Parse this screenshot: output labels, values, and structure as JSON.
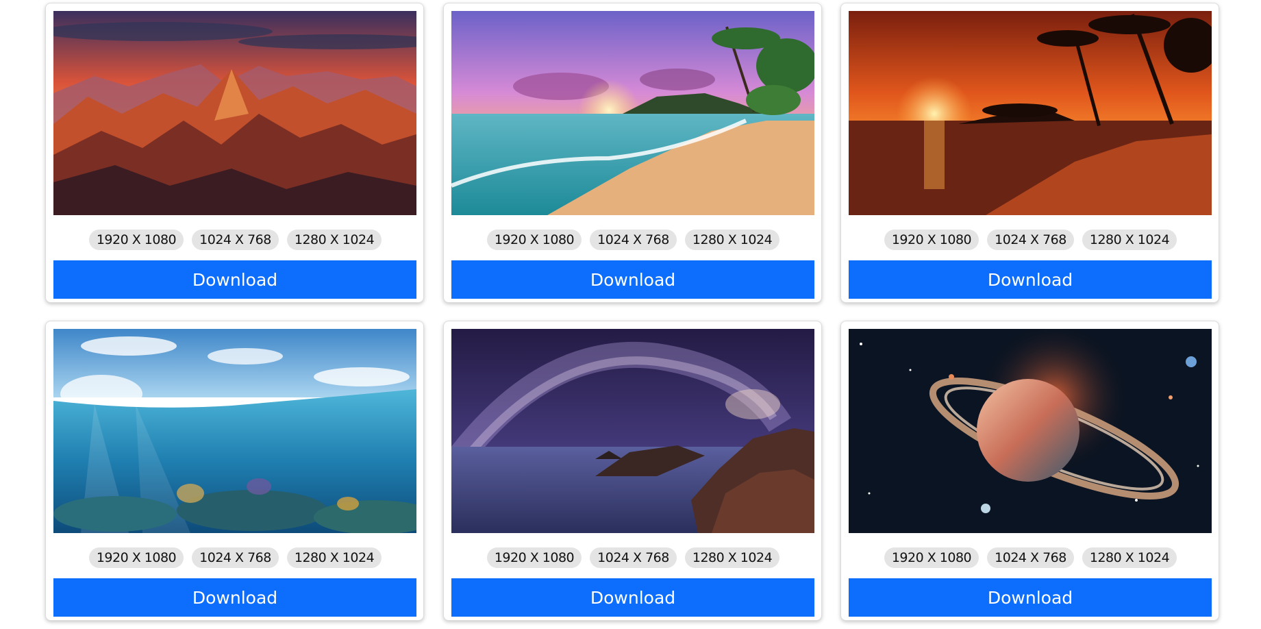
{
  "resolutions": [
    "1920 X 1080",
    "1024 X 768",
    "1280 X 1024"
  ],
  "download_label": "Download",
  "accent_color": "#0d6efd",
  "cards": [
    {
      "image": "mountain-sunset-image"
    },
    {
      "image": "tropical-beach-sunset-image"
    },
    {
      "image": "palm-beach-sunset-image"
    },
    {
      "image": "underwater-reef-image"
    },
    {
      "image": "milky-way-coast-image"
    },
    {
      "image": "ringed-planet-space-image"
    }
  ]
}
